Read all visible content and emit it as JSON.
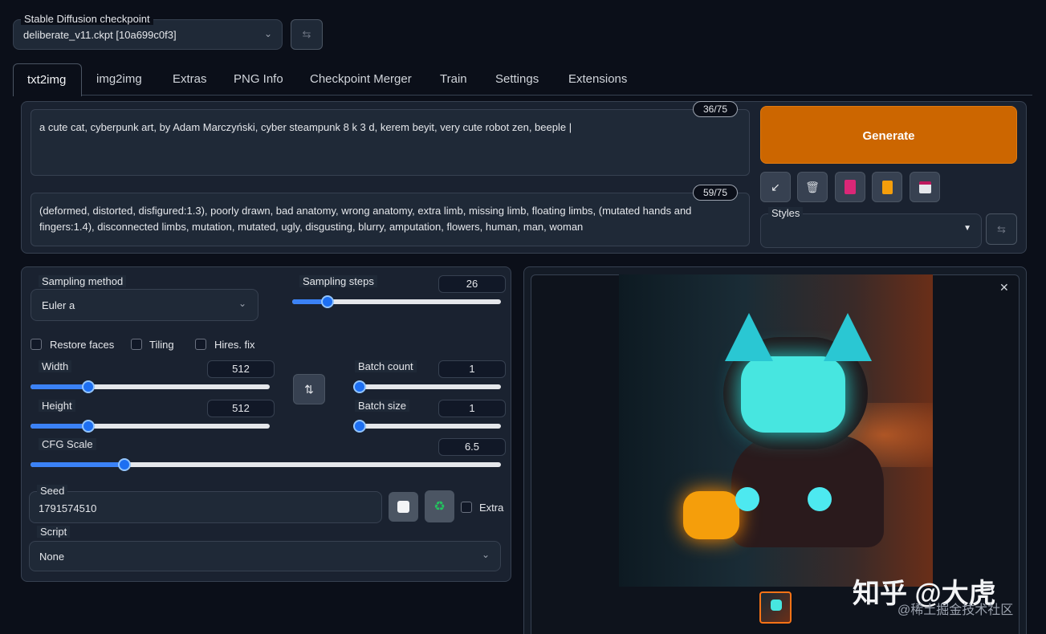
{
  "checkpoint": {
    "label": "Stable Diffusion checkpoint",
    "value": "deliberate_v11.ckpt [10a699c0f3]"
  },
  "tabs": [
    "txt2img",
    "img2img",
    "Extras",
    "PNG Info",
    "Checkpoint Merger",
    "Train",
    "Settings",
    "Extensions"
  ],
  "prompt": {
    "text": "a cute cat, cyberpunk art, by Adam Marczyński, cyber steampunk 8 k 3 d, kerem beyit, very cute robot zen, beeple |",
    "count": "36/75"
  },
  "negative_prompt": {
    "text": "(deformed, distorted, disfigured:1.3), poorly drawn, bad anatomy, wrong anatomy, extra limb, missing limb, floating limbs, (mutated hands and fingers:1.4), disconnected limbs, mutation, mutated, ugly, disgusting, blurry, amputation, flowers, human, man, woman",
    "count": "59/75"
  },
  "generate_label": "Generate",
  "styles_label": "Styles",
  "sampling_method": {
    "label": "Sampling method",
    "value": "Euler a"
  },
  "sampling_steps": {
    "label": "Sampling steps",
    "value": "26",
    "fraction": 0.17
  },
  "checkboxes": {
    "restore_faces": "Restore faces",
    "tiling": "Tiling",
    "hires_fix": "Hires. fix"
  },
  "width": {
    "label": "Width",
    "value": "512",
    "fraction": 0.24
  },
  "height": {
    "label": "Height",
    "value": "512",
    "fraction": 0.24
  },
  "batch_count": {
    "label": "Batch count",
    "value": "1",
    "fraction": 0.0
  },
  "batch_size": {
    "label": "Batch size",
    "value": "1",
    "fraction": 0.0
  },
  "cfg_scale": {
    "label": "CFG Scale",
    "value": "6.5",
    "fraction": 0.2
  },
  "seed": {
    "label": "Seed",
    "value": "1791574510",
    "extra_label": "Extra"
  },
  "script": {
    "label": "Script",
    "value": "None"
  },
  "watermark": {
    "main": "知乎 @大虎",
    "sub": "@稀土掘金技术社区"
  },
  "colors": {
    "accent": "#3b82f6",
    "generate": "#cc6600",
    "background": "#0b0f19"
  }
}
